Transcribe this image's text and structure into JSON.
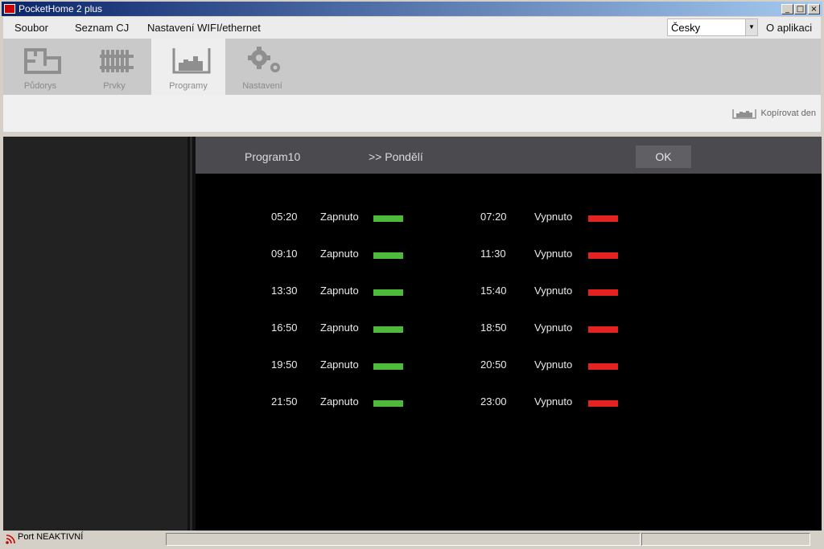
{
  "window": {
    "title": "PocketHome 2 plus",
    "controls": {
      "minimize": "_",
      "maximize": "□",
      "close": "×"
    }
  },
  "menu": {
    "items": [
      {
        "label": "Soubor"
      },
      {
        "label": "Seznam CJ"
      },
      {
        "label": "Nastavení WIFI/ethernet"
      }
    ],
    "language": "Česky",
    "about": "O aplikaci"
  },
  "toolbar": {
    "tools": [
      {
        "label": "Půdorys",
        "icon": "floorplan-icon"
      },
      {
        "label": "Prvky",
        "icon": "radiator-icon"
      },
      {
        "label": "Programy",
        "icon": "program-chart-icon",
        "active": true
      },
      {
        "label": "Nastavení",
        "icon": "gears-icon"
      }
    ],
    "copy_day": "Kopírovat den"
  },
  "program": {
    "name": "Program10",
    "day": ">> Pondělí",
    "ok": "OK",
    "on_entries": [
      {
        "time": "05:20",
        "state": "Zapnuto"
      },
      {
        "time": "09:10",
        "state": "Zapnuto"
      },
      {
        "time": "13:30",
        "state": "Zapnuto"
      },
      {
        "time": "16:50",
        "state": "Zapnuto"
      },
      {
        "time": "19:50",
        "state": "Zapnuto"
      },
      {
        "time": "21:50",
        "state": "Zapnuto"
      }
    ],
    "off_entries": [
      {
        "time": "07:20",
        "state": "Vypnuto"
      },
      {
        "time": "11:30",
        "state": "Vypnuto"
      },
      {
        "time": "15:40",
        "state": "Vypnuto"
      },
      {
        "time": "18:50",
        "state": "Vypnuto"
      },
      {
        "time": "20:50",
        "state": "Vypnuto"
      },
      {
        "time": "23:00",
        "state": "Vypnuto"
      }
    ],
    "colors": {
      "on": "#4dba3c",
      "off": "#e52222"
    }
  },
  "status": {
    "port": "Port NEAKTIVNÍ",
    "icon": "signal-icon"
  }
}
